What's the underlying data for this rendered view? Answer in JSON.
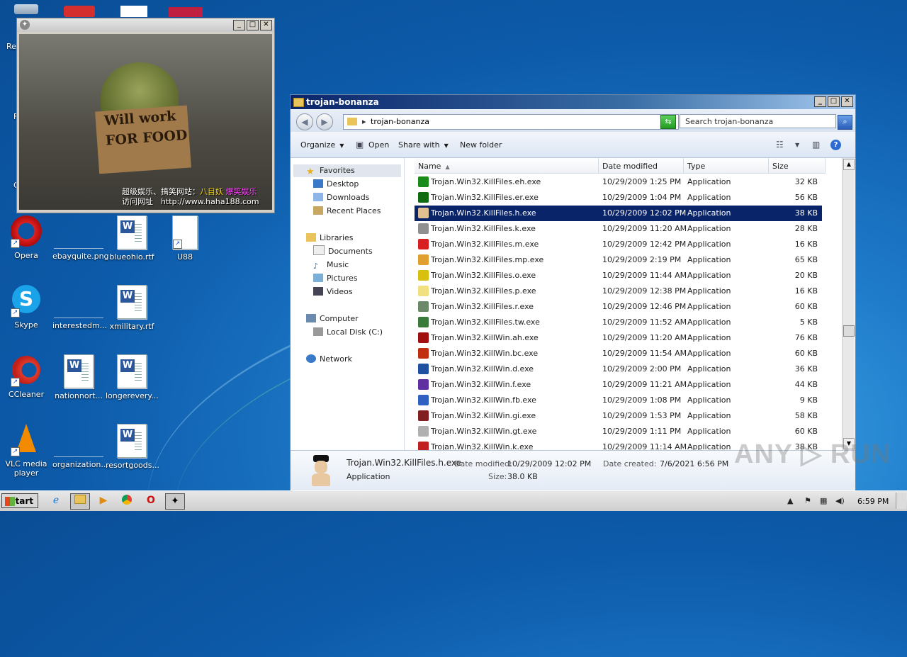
{
  "desktop": {
    "icons": [
      {
        "label": "Opera"
      },
      {
        "label": "ebayquite.png"
      },
      {
        "label": "blueohio.rtf"
      },
      {
        "label": "U88"
      },
      {
        "label": "Skype"
      },
      {
        "label": "interestedm..."
      },
      {
        "label": "xmilitary.rtf"
      },
      {
        "label": "CCleaner"
      },
      {
        "label": "nationnort..."
      },
      {
        "label": "longerevery..."
      },
      {
        "label": "VLC media player"
      },
      {
        "label": "organization..."
      },
      {
        "label": "resortgoods..."
      }
    ],
    "partial_labels": [
      "Re",
      "F",
      "C"
    ]
  },
  "photo_window": {
    "sign_line1": "Will work",
    "sign_line2": "FOR FOOD",
    "caption_line1_a": "超级娱乐、搞笑网站：",
    "caption_line1_b": "八目妖",
    "caption_line1_c": "爆笑娱乐",
    "caption_line2": "访问网址　http://www.haha188.com"
  },
  "explorer": {
    "title": "trojan-bonanza",
    "address": "trojan-bonanza",
    "search_placeholder": "Search trojan-bonanza",
    "toolbar": {
      "organize": "Organize",
      "open": "Open",
      "share_with": "Share with",
      "new_folder": "New folder"
    },
    "nav": {
      "favorites": "Favorites",
      "desktop": "Desktop",
      "downloads": "Downloads",
      "recent": "Recent Places",
      "libraries": "Libraries",
      "documents": "Documents",
      "music": "Music",
      "pictures": "Pictures",
      "videos": "Videos",
      "computer": "Computer",
      "local_disk": "Local Disk (C:)",
      "network": "Network"
    },
    "columns": {
      "name": "Name",
      "date": "Date modified",
      "type": "Type",
      "size": "Size"
    },
    "files": [
      {
        "name": "Trojan.Win32.KillFiles.eh.exe",
        "date": "10/29/2009 1:25 PM",
        "type": "Application",
        "size": "32 KB",
        "color": "#1a8a1a"
      },
      {
        "name": "Trojan.Win32.KillFiles.er.exe",
        "date": "10/29/2009 1:04 PM",
        "type": "Application",
        "size": "56 KB",
        "color": "#0f6b0f"
      },
      {
        "name": "Trojan.Win32.KillFiles.h.exe",
        "date": "10/29/2009 12:02 PM",
        "type": "Application",
        "size": "38 KB",
        "color": "#e0c090",
        "selected": true
      },
      {
        "name": "Trojan.Win32.KillFiles.k.exe",
        "date": "10/29/2009 11:20 AM",
        "type": "Application",
        "size": "28 KB",
        "color": "#909090"
      },
      {
        "name": "Trojan.Win32.KillFiles.m.exe",
        "date": "10/29/2009 12:42 PM",
        "type": "Application",
        "size": "16 KB",
        "color": "#d82020"
      },
      {
        "name": "Trojan.Win32.KillFiles.mp.exe",
        "date": "10/29/2009 2:19 PM",
        "type": "Application",
        "size": "65 KB",
        "color": "#e0a030"
      },
      {
        "name": "Trojan.Win32.KillFiles.o.exe",
        "date": "10/29/2009 11:44 AM",
        "type": "Application",
        "size": "20 KB",
        "color": "#d8c010"
      },
      {
        "name": "Trojan.Win32.KillFiles.p.exe",
        "date": "10/29/2009 12:38 PM",
        "type": "Application",
        "size": "16 KB",
        "color": "#f0e080"
      },
      {
        "name": "Trojan.Win32.KillFiles.r.exe",
        "date": "10/29/2009 12:46 PM",
        "type": "Application",
        "size": "60 KB",
        "color": "#6a8a6a"
      },
      {
        "name": "Trojan.Win32.KillFiles.tw.exe",
        "date": "10/29/2009 11:52 AM",
        "type": "Application",
        "size": "5 KB",
        "color": "#3a7a3a"
      },
      {
        "name": "Trojan.Win32.KillWin.ah.exe",
        "date": "10/29/2009 11:20 AM",
        "type": "Application",
        "size": "76 KB",
        "color": "#a01010"
      },
      {
        "name": "Trojan.Win32.KillWin.bc.exe",
        "date": "10/29/2009 11:54 AM",
        "type": "Application",
        "size": "60 KB",
        "color": "#c03010"
      },
      {
        "name": "Trojan.Win32.KillWin.d.exe",
        "date": "10/29/2009 2:00 PM",
        "type": "Application",
        "size": "36 KB",
        "color": "#2050a0"
      },
      {
        "name": "Trojan.Win32.KillWin.f.exe",
        "date": "10/29/2009 11:21 AM",
        "type": "Application",
        "size": "44 KB",
        "color": "#6030a0"
      },
      {
        "name": "Trojan.Win32.KillWin.fb.exe",
        "date": "10/29/2009 1:08 PM",
        "type": "Application",
        "size": "9 KB",
        "color": "#3060c0"
      },
      {
        "name": "Trojan.Win32.KillWin.gi.exe",
        "date": "10/29/2009 1:53 PM",
        "type": "Application",
        "size": "58 KB",
        "color": "#802020"
      },
      {
        "name": "Trojan.Win32.KillWin.gt.exe",
        "date": "10/29/2009 1:11 PM",
        "type": "Application",
        "size": "60 KB",
        "color": "#b0b0b0"
      },
      {
        "name": "Trojan.Win32.KillWin.k.exe",
        "date": "10/29/2009 11:14 AM",
        "type": "Application",
        "size": "38 KB",
        "color": "#c02020"
      }
    ],
    "details": {
      "name": "Trojan.Win32.KillFiles.h.exe",
      "type": "Application",
      "date_modified_label": "Date modified:",
      "date_modified": "10/29/2009 12:02 PM",
      "size_label": "Size:",
      "size": "38.0 KB",
      "date_created_label": "Date created:",
      "date_created": "7/6/2021 6:56 PM"
    }
  },
  "taskbar": {
    "start": "Start",
    "clock": "6:59 PM"
  },
  "watermark": "ANY ▷ RUN"
}
